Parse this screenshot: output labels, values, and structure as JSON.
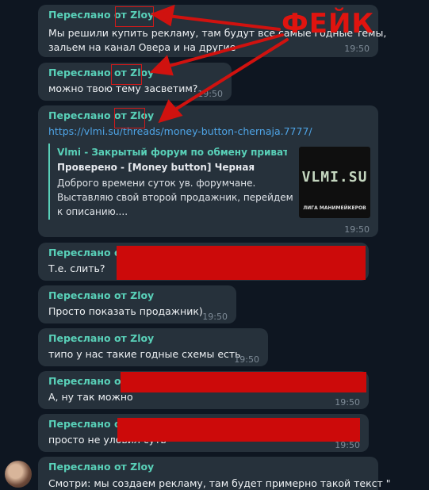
{
  "fake_label": "ФЕЙК",
  "messages": [
    {
      "forward": "Переслано от Zloy",
      "text": "Мы решили купить рекламу, там будут все самые годные темы,",
      "text2": "зальем на канал Овера и на другие",
      "time": "19:50"
    },
    {
      "forward": "Переслано от Zloy",
      "text": "можно твою тему засветим?",
      "time": "19:50"
    },
    {
      "forward": "Переслано от Zloy",
      "link": "https://vlmi.su/threads/money-button-chernaja.7777/",
      "time": "19:50",
      "preview": {
        "site": "Vlmi - Закрытый форум по обмену приватн...",
        "title": "Проверено - [Money button] Черная",
        "desc": "Доброго времени суток ув. форумчане.\nВыставляю свой второй продажник, перейдем\nк описанию....",
        "logo": "VLMI.SU",
        "logo_sub": "ЛИГА МАНИМЕЙКЕРОВ"
      }
    },
    {
      "forward": "Переслано от",
      "text": "Т.е. слить?"
    },
    {
      "forward": "Переслано от Zloy",
      "text": "Просто показать продажник)",
      "time": "19:50"
    },
    {
      "forward": "Переслано от Zloy",
      "text": "типо у нас такие годные схемы есть",
      "time": "19:50"
    },
    {
      "forward": "Переслано от",
      "text": "А, ну так можно",
      "time": "19:50"
    },
    {
      "forward": "Переслано от",
      "text": "просто не уловил суть",
      "time": "19:50"
    },
    {
      "forward": "Переслано от Zloy",
      "text": "Смотри: мы создаем рекламу, там будет примерно такой текст \""
    }
  ]
}
